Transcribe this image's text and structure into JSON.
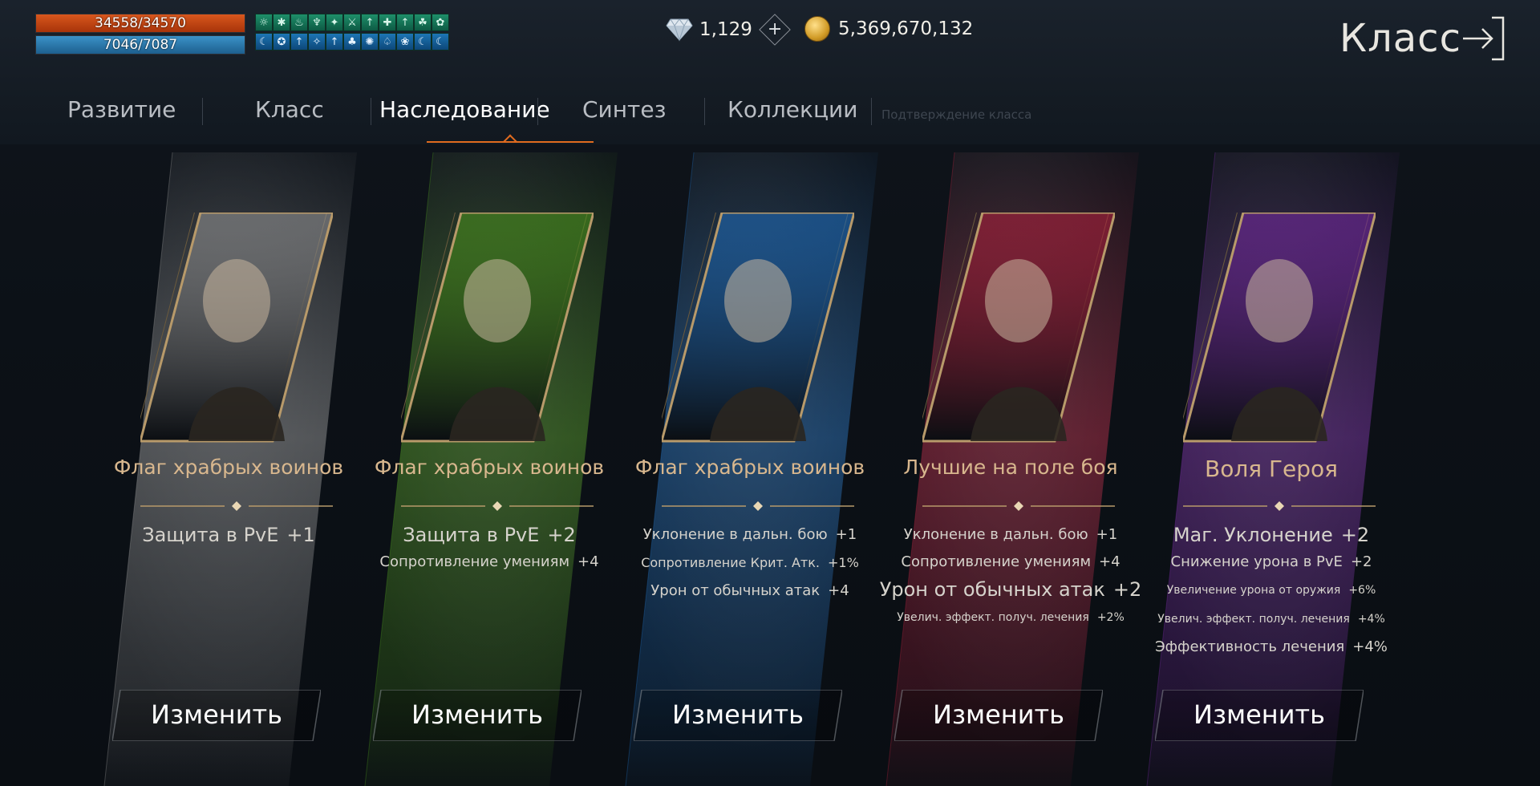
{
  "hud": {
    "hp": "34558/34570",
    "mp": "7046/7087",
    "buffs_top": [
      "☼",
      "✱",
      "♨",
      "♆",
      "✦",
      "⚔",
      "↑",
      "✚",
      "↑",
      "☘",
      "✿"
    ],
    "buffs_bottom": [
      "☾",
      "✪",
      "↑",
      "✧",
      "↑",
      "♣",
      "✺",
      "♤",
      "❀",
      "☾",
      "☾"
    ],
    "diamonds": "1,129",
    "gold": "5,369,670,132"
  },
  "header": {
    "title": "Класс"
  },
  "tabs": {
    "items": [
      "Развитие",
      "Класс",
      "Наследование",
      "Синтез",
      "Коллекции"
    ],
    "disabled": "Подтверждение класса",
    "active_index": 2
  },
  "cards": [
    {
      "name": "Флаг храбрых воинов",
      "theme": "#9a9a9a",
      "stats": [
        {
          "label": "Защита в PvE",
          "value": "+1"
        }
      ],
      "button": "Изменить"
    },
    {
      "name": "Флаг храбрых воинов",
      "theme": "#4e9a1d",
      "stats": [
        {
          "label": "Защита в PvE",
          "value": "+2"
        },
        {
          "label": "Сопротивление умениям",
          "value": "+4"
        }
      ],
      "button": "Изменить"
    },
    {
      "name": "Флаг храбрых воинов",
      "theme": "#1f6fc0",
      "stats": [
        {
          "label": "Уклонение в дальн. бою",
          "value": "+1"
        },
        {
          "label": "Сопротивление Крит. Атк.",
          "value": "+1%"
        },
        {
          "label": "Урон от обычных атак",
          "value": "+4"
        }
      ],
      "button": "Изменить"
    },
    {
      "name": "Лучшие на поле боя",
      "theme": "#b8213f",
      "stats": [
        {
          "label": "Уклонение в дальн. бою",
          "value": "+1"
        },
        {
          "label": "Сопротивление умениям",
          "value": "+4"
        },
        {
          "label": "Урон от обычных атак",
          "value": "+2"
        },
        {
          "label": "Увелич. эффект. получ. лечения",
          "value": "+2%"
        }
      ],
      "button": "Изменить"
    },
    {
      "name": "Воля Героя",
      "theme": "#7a2aa8",
      "stats": [
        {
          "label": "Маг. Уклонение",
          "value": "+2"
        },
        {
          "label": "Снижение урона в PvE",
          "value": "+2"
        },
        {
          "label": "Увеличение урона от оружия",
          "value": "+6%"
        },
        {
          "label": "Увелич. эффект. получ. лечения",
          "value": "+4%"
        },
        {
          "label": "Эффективность лечения",
          "value": "+4%"
        }
      ],
      "button": "Изменить"
    }
  ]
}
